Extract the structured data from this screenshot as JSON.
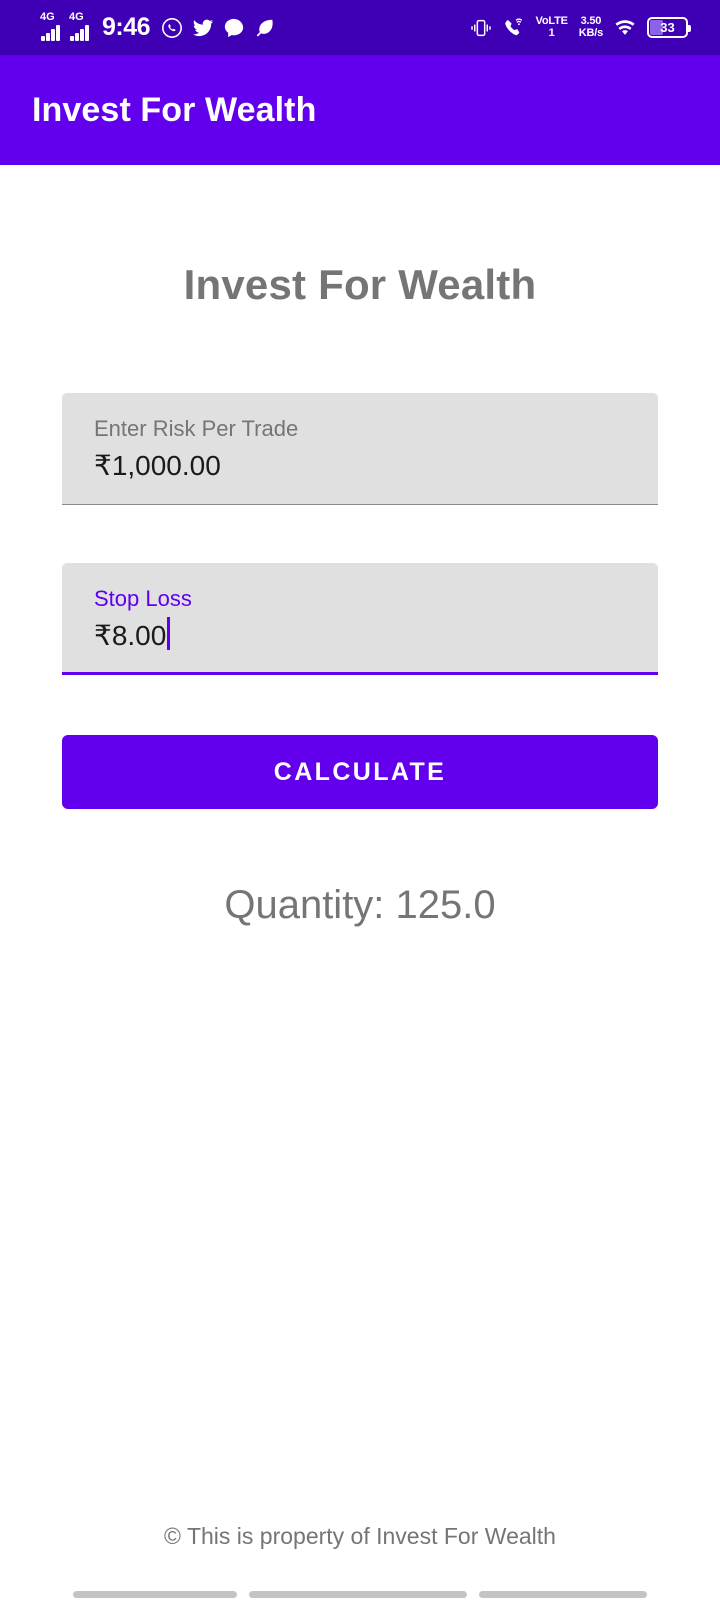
{
  "status_bar": {
    "network_labels": [
      "4G",
      "4G"
    ],
    "time": "9:46",
    "left_icons": [
      "whatsapp-icon",
      "twitter-icon",
      "chat-bubble-icon",
      "leaf-icon"
    ],
    "right_icons": [
      "vibrate-icon",
      "wifi-calling-icon",
      "wifi-icon"
    ],
    "volte_line1": "VoLTE",
    "volte_line2": "1",
    "volte_label": "VoLTE1",
    "data_rate_value": "3.50",
    "data_rate_unit": "KB/s",
    "battery_percent": "33",
    "background_color": "#3F00B5"
  },
  "app_bar": {
    "title": "Invest For Wealth",
    "background_color": "#6200EE",
    "text_color": "#FFFFFF"
  },
  "main": {
    "page_title": "Invest For Wealth",
    "fields": [
      {
        "name": "risk-per-trade",
        "label": "Enter Risk Per Trade",
        "value": "₹1,000.00",
        "focused": false
      },
      {
        "name": "stop-loss",
        "label": "Stop Loss",
        "value": "₹8.00",
        "focused": true
      }
    ],
    "calculate_button_label": "CALCULATE",
    "result_text": "Quantity: 125.0",
    "accent_color": "#6200EE",
    "field_background_color": "#E0E0E0",
    "muted_text_color": "#757575"
  },
  "footer": {
    "copyright_text": "© This is property of Invest For Wealth"
  },
  "nav_bar": {
    "pills": [
      "recents-pill",
      "home-pill",
      "back-pill"
    ]
  }
}
